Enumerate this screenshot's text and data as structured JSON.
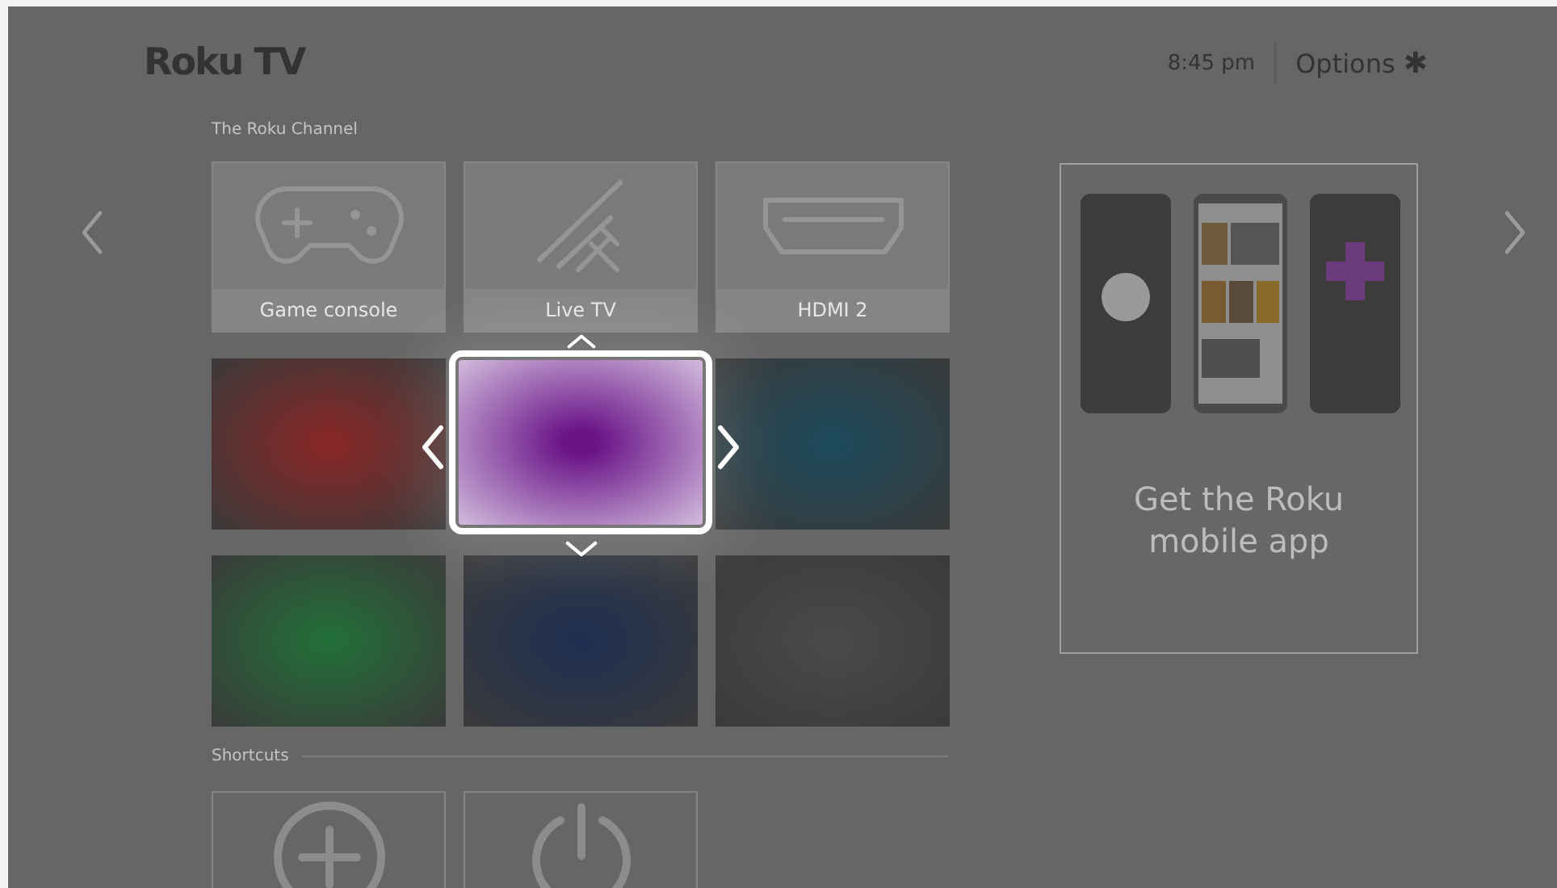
{
  "header": {
    "logo": "Roku TV",
    "time": "8:45 pm",
    "options": "Options",
    "options_icon": "✱"
  },
  "channels": {
    "title": "The Roku Channel",
    "tiles": [
      {
        "kind": "gamepad",
        "label": "Game console",
        "selected": false
      },
      {
        "kind": "antenna",
        "label": "Live TV",
        "selected": false
      },
      {
        "kind": "hdmi",
        "label": "HDMI 2",
        "selected": false
      },
      {
        "kind": "color",
        "color": "#8a2626",
        "selected": false
      },
      {
        "kind": "color",
        "color": "#6a1488",
        "selected": true
      },
      {
        "kind": "color",
        "color": "#1c4a5c",
        "selected": false
      },
      {
        "kind": "color",
        "color": "#227038",
        "selected": false
      },
      {
        "kind": "color",
        "color": "#1e2f52",
        "selected": false
      },
      {
        "kind": "color",
        "color": "#4a4a4a",
        "selected": false
      }
    ]
  },
  "shortcuts": {
    "title": "Shortcuts",
    "tiles": [
      {
        "kind": "add"
      },
      {
        "kind": "power"
      }
    ]
  },
  "promo": {
    "text": "Get the Roku mobile app"
  }
}
